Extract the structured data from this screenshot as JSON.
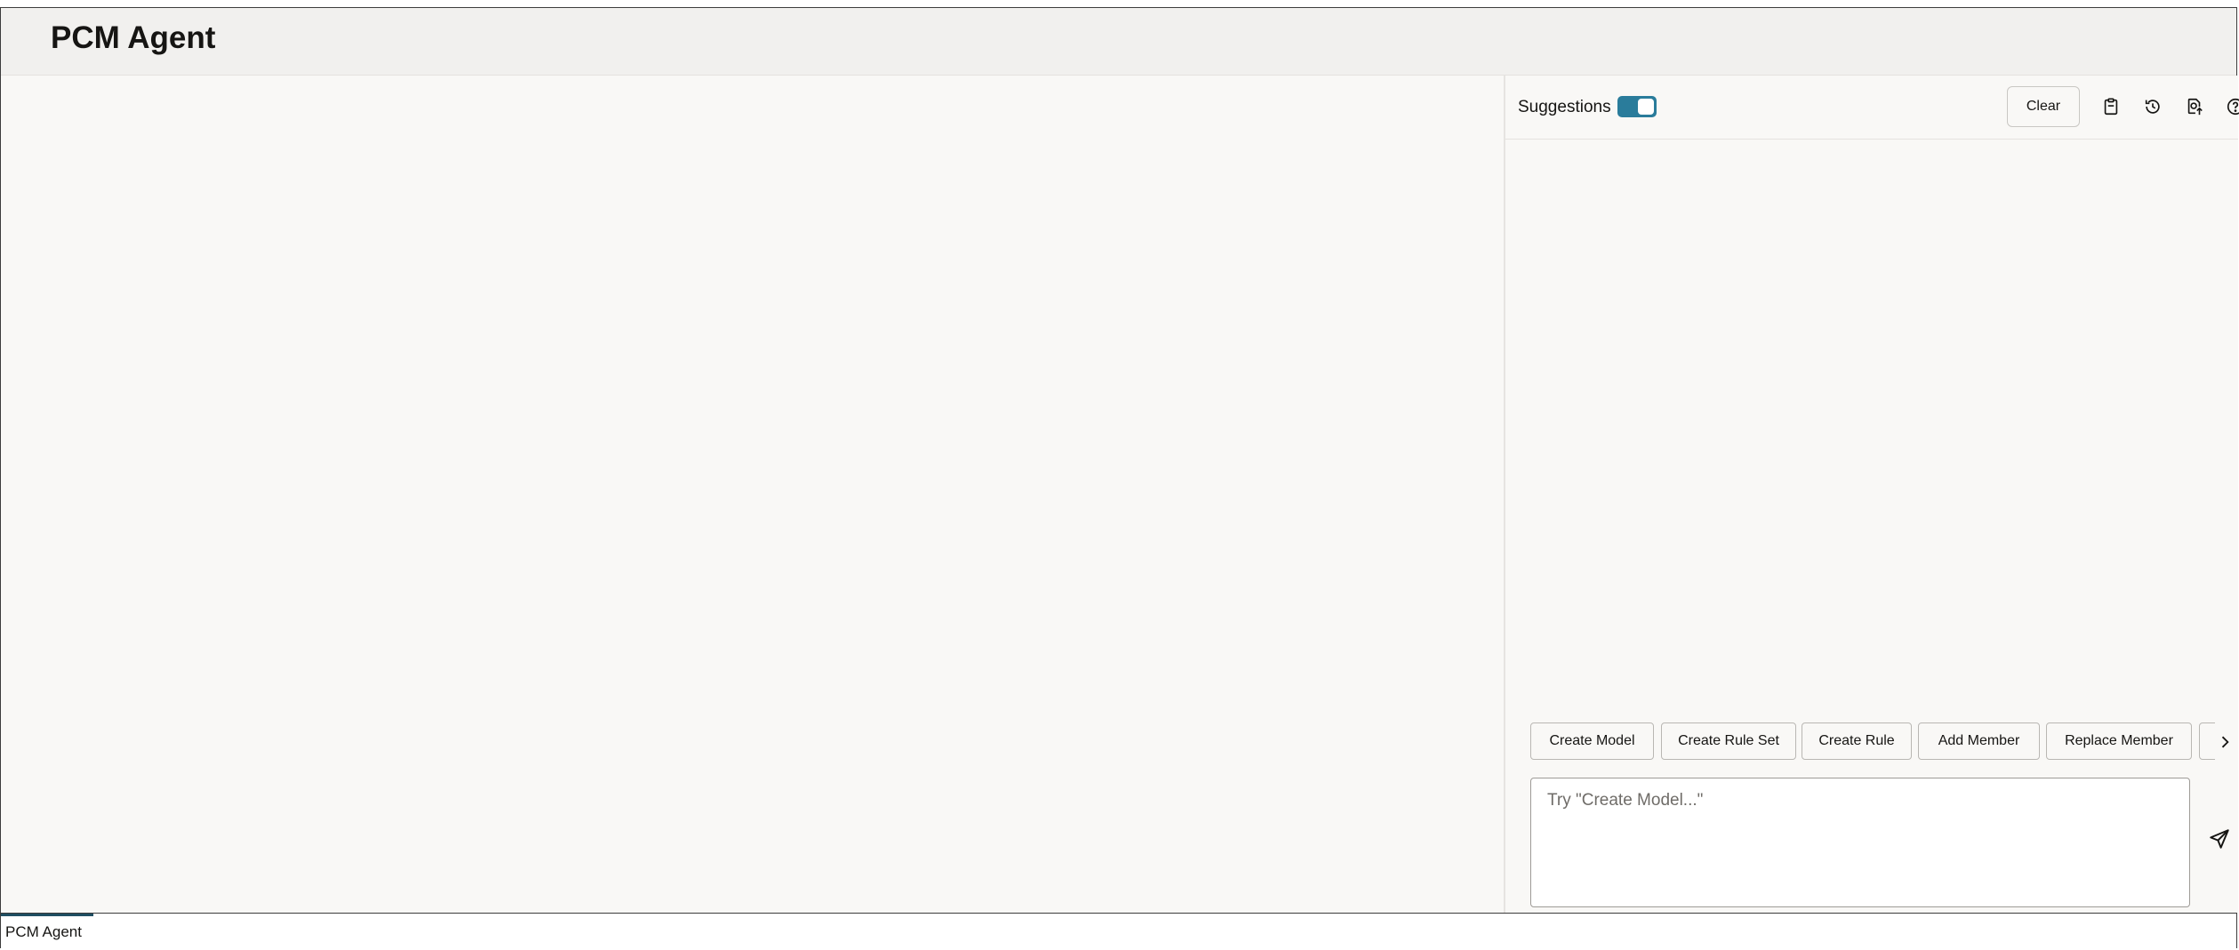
{
  "header": {
    "title": "PCM Agent"
  },
  "panel": {
    "suggestions_label": "Suggestions",
    "suggestions_enabled": true,
    "clear_label": "Clear",
    "toolbar_icons": [
      "clipboard-icon",
      "history-icon",
      "document-upload-icon",
      "help-icon"
    ]
  },
  "quick_actions": [
    {
      "label": "Create Model"
    },
    {
      "label": "Create Rule Set"
    },
    {
      "label": "Create Rule"
    },
    {
      "label": "Add Member"
    },
    {
      "label": "Replace Member"
    }
  ],
  "prompt": {
    "placeholder": "Try \"Create Model...\"",
    "value": ""
  },
  "footer": {
    "tab_label": "PCM Agent"
  },
  "colors": {
    "accent": "#2a7c9b",
    "tab_indicator": "#1f4e62"
  }
}
